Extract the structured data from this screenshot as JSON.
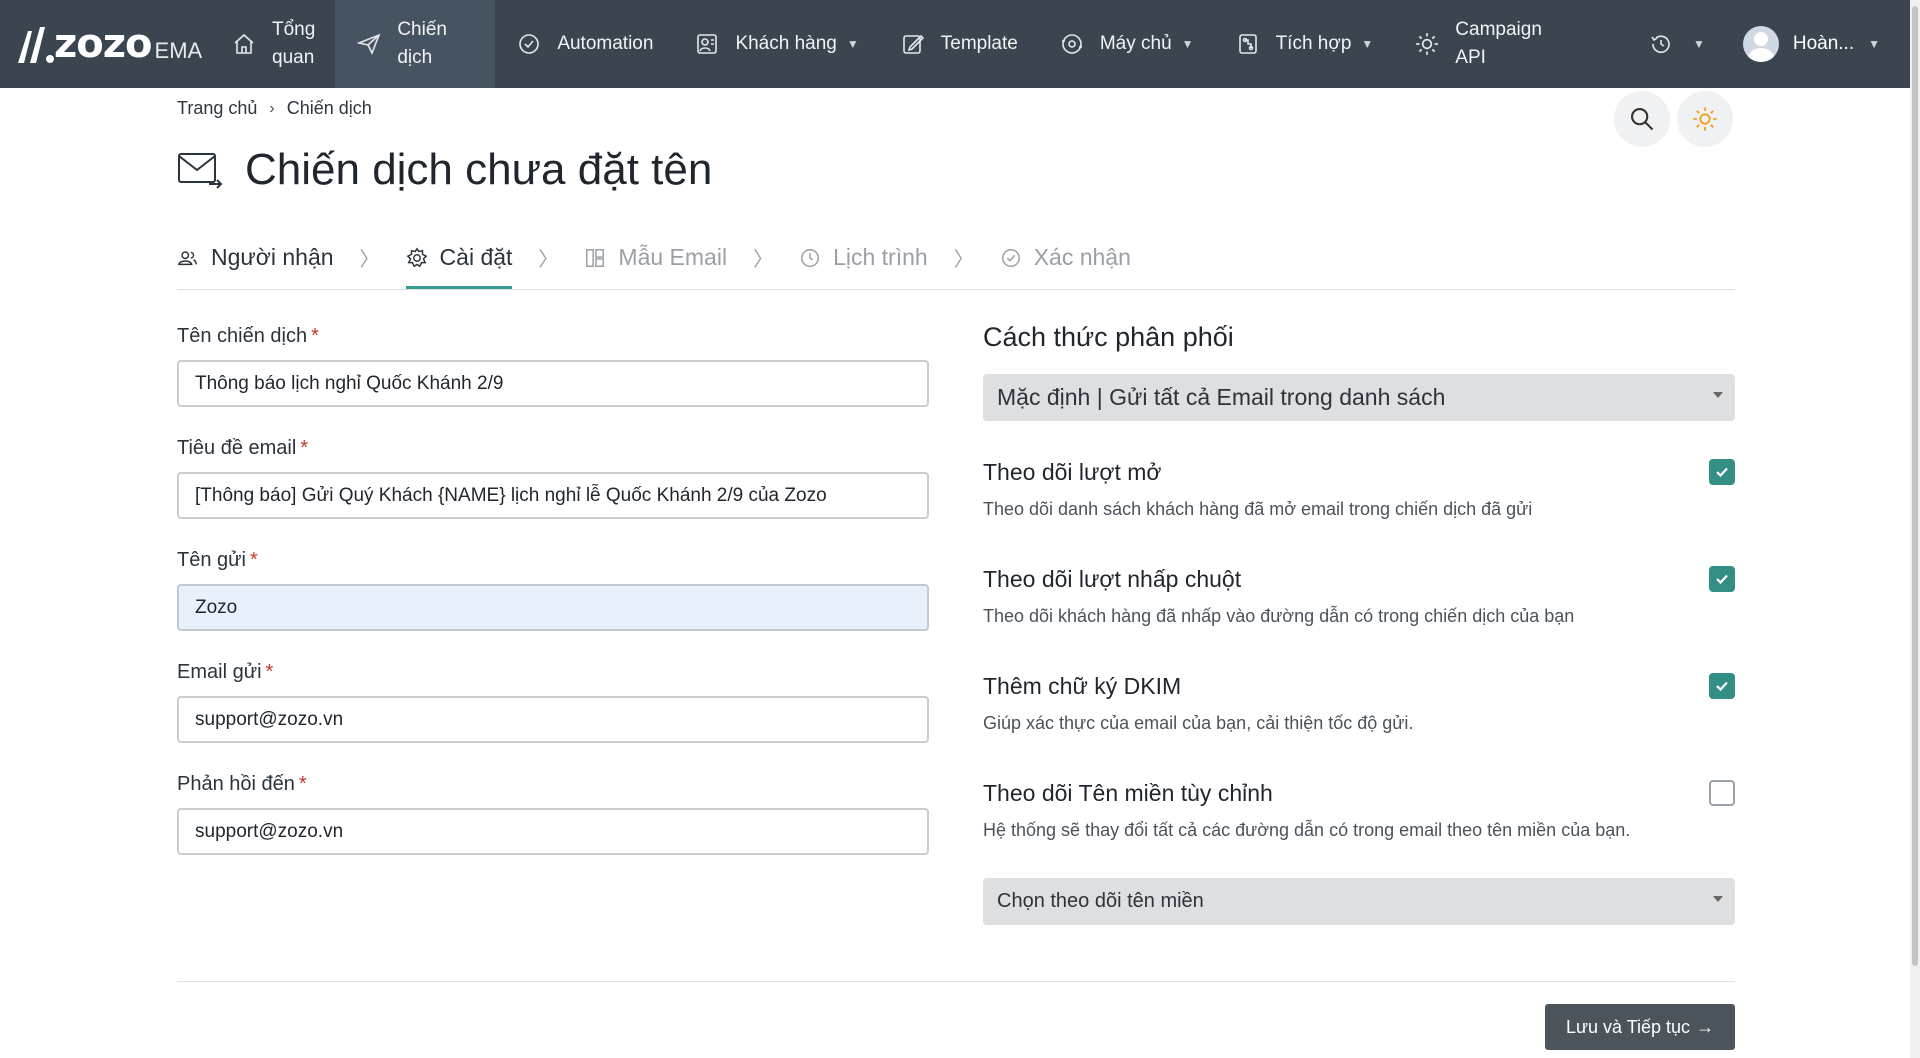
{
  "brand": {
    "logo": "zozo",
    "suffix": "EMA"
  },
  "nav": {
    "items": [
      {
        "label_1": "Tổng",
        "label_2": "quan",
        "icon": "home-icon"
      },
      {
        "label_1": "Chiến",
        "label_2": "dịch",
        "icon": "send-icon",
        "active": true
      },
      {
        "label": "Automation",
        "icon": "automation-icon"
      },
      {
        "label": "Khách hàng",
        "icon": "contacts-icon",
        "dropdown": true
      },
      {
        "label": "Template",
        "icon": "edit-template-icon"
      },
      {
        "label": "Máy chủ",
        "icon": "server-icon",
        "dropdown": true
      },
      {
        "label": "Tích hợp",
        "icon": "integration-icon",
        "dropdown": true
      },
      {
        "label_1": "Campaign",
        "label_2": "API",
        "icon": "api-gear-icon"
      }
    ],
    "user_name": "Hoàn..."
  },
  "breadcrumb": {
    "home": "Trang chủ",
    "current": "Chiến dịch"
  },
  "page_title": "Chiến dịch chưa đặt tên",
  "steps": [
    {
      "label": "Người nhận",
      "state": "done"
    },
    {
      "label": "Cài đặt",
      "state": "active"
    },
    {
      "label": "Mẫu Email",
      "state": "todo"
    },
    {
      "label": "Lịch trình",
      "state": "todo"
    },
    {
      "label": "Xác nhận",
      "state": "todo"
    }
  ],
  "form": {
    "campaign_name": {
      "label": "Tên chiến dịch",
      "value": "Thông báo lịch nghỉ Quốc Khánh 2/9"
    },
    "subject": {
      "label": "Tiêu đề email",
      "value": "[Thông báo] Gửi Quý Khách {NAME} lịch nghỉ lễ Quốc Khánh 2/9 của Zozo"
    },
    "sender_name": {
      "label": "Tên gửi",
      "value": "Zozo"
    },
    "sender_email": {
      "label": "Email gửi",
      "value": "support@zozo.vn"
    },
    "reply_to": {
      "label": "Phản hồi đến",
      "value": "support@zozo.vn"
    },
    "required_mark": "*"
  },
  "distribution": {
    "heading": "Cách thức phân phối",
    "selected": "Mặc định | Gửi tất cả Email trong danh sách"
  },
  "options": [
    {
      "title": "Theo dõi lượt mở",
      "desc": "Theo dõi danh sách khách hàng đã mở email trong chiến dịch đã gửi",
      "checked": true
    },
    {
      "title": "Theo dõi lượt nhấp chuột",
      "desc": "Theo dõi khách hàng đã nhấp vào đường dẫn có trong chiến dịch của bạn",
      "checked": true
    },
    {
      "title": "Thêm chữ ký DKIM",
      "desc": "Giúp xác thực của email của bạn, cải thiện tốc độ gửi.",
      "checked": true
    },
    {
      "title": "Theo dõi Tên miền tùy chỉnh",
      "desc": "Hệ thống sẽ thay đổi tất cả các đường dẫn có trong email theo tên miền của bạn.",
      "checked": false
    }
  ],
  "domain_select": {
    "placeholder": "Chọn theo dõi tên miền"
  },
  "save_button": {
    "label": "Lưu và Tiếp tục",
    "arrow": "→"
  },
  "colors": {
    "nav_bg": "#3a4550",
    "accent": "#338f85",
    "button": "#4c555c"
  }
}
